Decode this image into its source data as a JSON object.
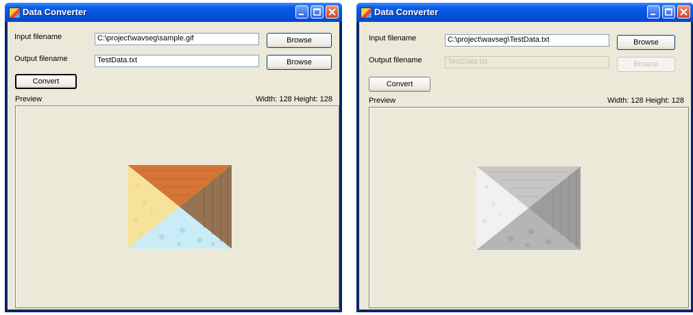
{
  "windows": [
    {
      "title": "Data Converter",
      "input_label": "Input filename",
      "input_value": "C:\\project\\wavseg\\sample.gif",
      "output_label": "Output filename",
      "output_value": "TestData.txt",
      "browse_input": "Browse",
      "browse_output": "Browse",
      "convert": "Convert",
      "preview_label": "Preview",
      "dimensions": "Width: 128  Height: 128",
      "image_style": "color"
    },
    {
      "title": "Data Converter",
      "input_label": "Input filename",
      "input_value": "C:\\project\\wavseg\\TestData.txt",
      "output_label": "Output filename",
      "output_value": "TestData.txt",
      "browse_input": "Browse",
      "browse_output": "Browse",
      "convert": "Convert",
      "preview_label": "Preview",
      "dimensions": "Width: 128  Height: 128",
      "image_style": "grayscale"
    }
  ],
  "colors": {
    "color_image": {
      "top": "#d97a3a",
      "left": "#f7e49a",
      "bottom": "#c8ecf5",
      "right": "#9c7a55"
    },
    "gray_image": {
      "top": "#c9c9c9",
      "left": "#f2f2f2",
      "bottom": "#b3b3b3",
      "right": "#9a9a9a"
    }
  }
}
